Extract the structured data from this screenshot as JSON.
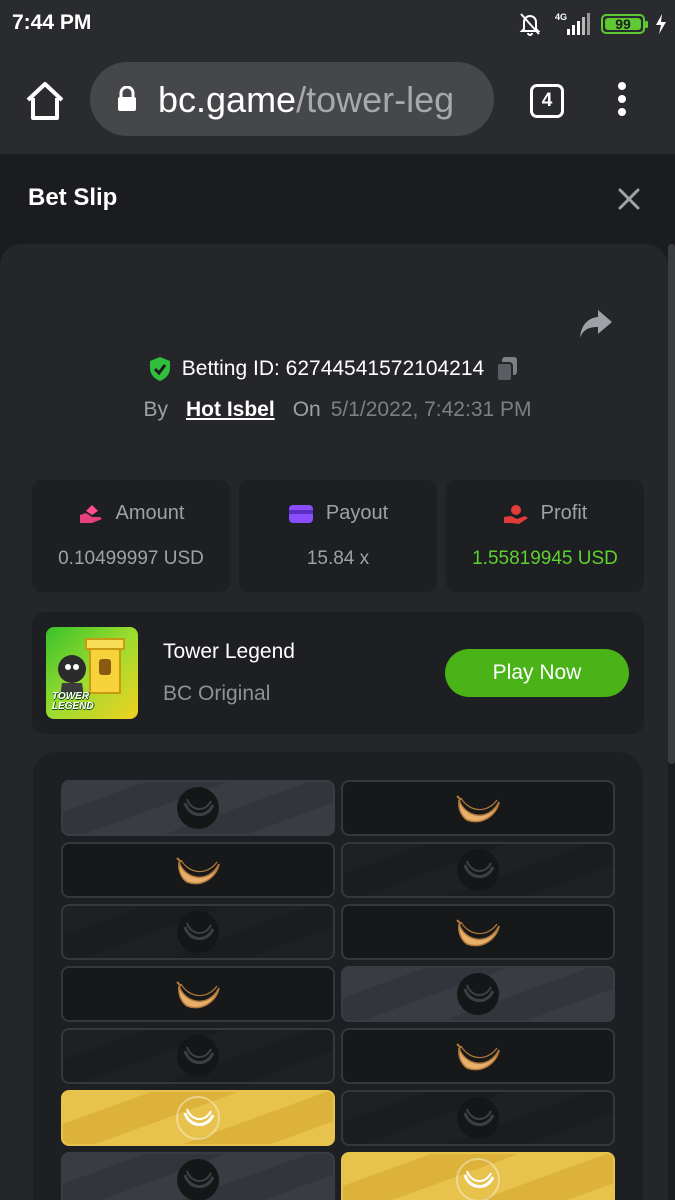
{
  "status_bar": {
    "time": "7:44 PM",
    "network": "4G",
    "battery": "99"
  },
  "browser": {
    "url_host": "bc.game",
    "url_path": "/tower-leg",
    "tab_count": "4"
  },
  "slip": {
    "title": "Bet Slip"
  },
  "bet": {
    "betting_id": "Betting ID: 62744541572104214",
    "by_label": "By",
    "user": "Hot Isbel",
    "on_label": "On",
    "date": "5/1/2022, 7:42:31 PM"
  },
  "stats": {
    "amount": {
      "label": "Amount",
      "value": "0.10499997 USD"
    },
    "payout": {
      "label": "Payout",
      "value": "15.84 x"
    },
    "profit": {
      "label": "Profit",
      "value": "1.55819945 USD"
    }
  },
  "game": {
    "name": "Tower Legend",
    "provider": "BC Original",
    "thumb_text_1": "TOWER",
    "thumb_text_2": "LEGEND",
    "play_label": "Play Now"
  },
  "colors": {
    "background": "#1b1c1f",
    "card": "#25262a",
    "accent_green": "#49b317",
    "profit_green": "#5fd12e",
    "banana": "#e8b06a",
    "gold_tile": "#e7c24c"
  },
  "tower_rows": [
    [
      "picked-empty",
      "banana"
    ],
    [
      "banana",
      "dim-empty"
    ],
    [
      "dim-empty",
      "banana"
    ],
    [
      "banana",
      "picked-empty"
    ],
    [
      "dim-empty",
      "banana"
    ],
    [
      "gold-banana",
      "dim-empty"
    ],
    [
      "picked-empty",
      "gold-banana"
    ]
  ]
}
